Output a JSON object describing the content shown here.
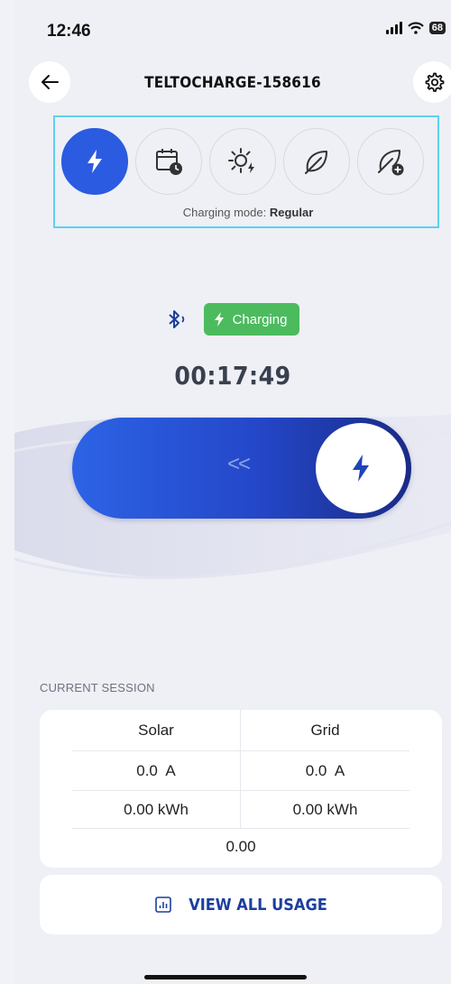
{
  "status_bar": {
    "time": "12:46",
    "battery": "68"
  },
  "header": {
    "title": "TELTOCHARGE-158616"
  },
  "modes": {
    "items": [
      {
        "icon": "lightning-icon",
        "active": true
      },
      {
        "icon": "calendar-clock-icon",
        "active": false
      },
      {
        "icon": "sun-lightning-icon",
        "active": false
      },
      {
        "icon": "leaf-icon",
        "active": false
      },
      {
        "icon": "leaf-plus-icon",
        "active": false
      }
    ],
    "caption_prefix": "Charging mode: ",
    "caption_value": "Regular"
  },
  "charging": {
    "status": "Charging",
    "timer": "00:17:49",
    "slider_hint": "<<"
  },
  "session": {
    "label": "CURRENT SESSION",
    "headers": [
      "Solar",
      "Grid"
    ],
    "current": [
      "0.0  A",
      "0.0  A"
    ],
    "energy": [
      "0.00 kWh",
      "0.00 kWh"
    ],
    "total": "0.00"
  },
  "usage_button": {
    "label": "VIEW ALL USAGE"
  },
  "colors": {
    "accent": "#2b5be0",
    "charging_green": "#4cbb5e",
    "highlight_border": "#5fd0ef",
    "dark_blue": "#1c3f9e"
  }
}
